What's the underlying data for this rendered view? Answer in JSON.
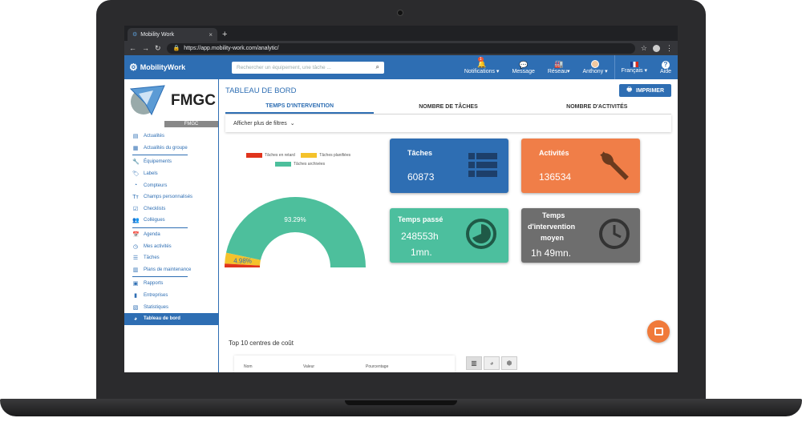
{
  "browser": {
    "tab_title": "Mobility Work",
    "tab_close": "×",
    "new_tab": "+",
    "url": "https://app.mobility-work.com/analytic/"
  },
  "header": {
    "logo_text": "MobilityWork",
    "search_placeholder": "Rechercher un équipement, une tâche ...",
    "nav": [
      {
        "label": "Notifications ▾",
        "icon": "bell-icon",
        "glyph": "🔔",
        "badge": "1"
      },
      {
        "label": "Message",
        "icon": "chat-icon",
        "glyph": "💬"
      },
      {
        "label": "Réseau▾",
        "icon": "factory-icon",
        "glyph": "🏭"
      },
      {
        "label": "Anthony ▾",
        "icon": "avatar"
      },
      {
        "label": "Français ▾",
        "icon": "flag-fr-icon"
      },
      {
        "label": "Aide",
        "icon": "help-icon",
        "glyph": "?"
      }
    ]
  },
  "sidebar": {
    "brand": "FMGC",
    "brand_sub": "FMGC",
    "items": [
      {
        "label": "Actualités",
        "icon": "news-icon",
        "glyph": "▤"
      },
      {
        "label": "Actualités du groupe",
        "icon": "group-news-icon",
        "glyph": "▦"
      },
      {
        "label": "Équipements",
        "icon": "wrench-icon",
        "glyph": "🔧"
      },
      {
        "label": "Labels",
        "icon": "tag-icon",
        "glyph": "🏷"
      },
      {
        "label": "Compteurs",
        "icon": "gauge-icon",
        "glyph": "◔"
      },
      {
        "label": "Champs personnalisés",
        "icon": "text-field-icon",
        "glyph": "Tт"
      },
      {
        "label": "Checklists",
        "icon": "checklist-icon",
        "glyph": "☑"
      },
      {
        "label": "Collègues",
        "icon": "users-icon",
        "glyph": "👥"
      },
      {
        "label": "Agenda",
        "icon": "calendar-icon",
        "glyph": "📅"
      },
      {
        "label": "Mes activités",
        "icon": "activity-icon",
        "glyph": "◷"
      },
      {
        "label": "Tâches",
        "icon": "tasks-icon",
        "glyph": "☰"
      },
      {
        "label": "Plans de maintenance",
        "icon": "maintenance-plan-icon",
        "glyph": "▥"
      },
      {
        "label": "Rapports",
        "icon": "report-icon",
        "glyph": "▣"
      },
      {
        "label": "Entreprises",
        "icon": "building-icon",
        "glyph": "▮"
      },
      {
        "label": "Statistiques",
        "icon": "stats-icon",
        "glyph": "▧"
      },
      {
        "label": "Tableau de bord",
        "icon": "dashboard-icon",
        "glyph": "◕",
        "active": true
      }
    ]
  },
  "main": {
    "title": "TABLEAU DE BORD",
    "print_label": "IMPRIMER",
    "tabs": [
      "TEMPS D'INTERVENTION",
      "NOMBRE DE TÂCHES",
      "NOMBRE D'ACTIVITÉS"
    ],
    "filters_label": "Afficher plus de filtres",
    "legend": [
      {
        "label": "Tâches en retard",
        "color": "#e0341c"
      },
      {
        "label": "Tâches planifiées",
        "color": "#f4c22b"
      },
      {
        "label": "Tâches archivées",
        "color": "#4dbf9c"
      }
    ],
    "kpis": [
      {
        "title": "Tâches",
        "value": "60873",
        "color": "#2e6eb3",
        "icon": "list-icon"
      },
      {
        "title": "Activités",
        "value": "136534",
        "color": "#f07e48",
        "icon": "wrench-icon"
      },
      {
        "title": "Temps passé",
        "value_line1": "248553h",
        "value_line2": "1mn.",
        "color": "#4cbf9e",
        "icon": "pie-icon"
      },
      {
        "title_line1": "Temps",
        "title_line2": "d'intervention",
        "title_line3": "moyen",
        "value": "1h 49mn.",
        "color": "#6e6e6e",
        "icon": "clock-icon"
      }
    ],
    "cost_title": "Top 10 centres de coût",
    "cost_columns": [
      "Nom",
      "Valeur",
      "Pourcentage"
    ]
  },
  "chart_data": {
    "type": "pie",
    "variant": "half-donut",
    "categories": [
      "Tâches archivées",
      "Tâches planifiées",
      "Tâches en retard"
    ],
    "values": [
      93.29,
      4.98,
      1.73
    ],
    "labels": [
      "93.29%",
      "4.98%",
      ""
    ],
    "colors": [
      "#4dbf9c",
      "#f4c22b",
      "#e0341c"
    ],
    "legend_position": "top-left"
  }
}
